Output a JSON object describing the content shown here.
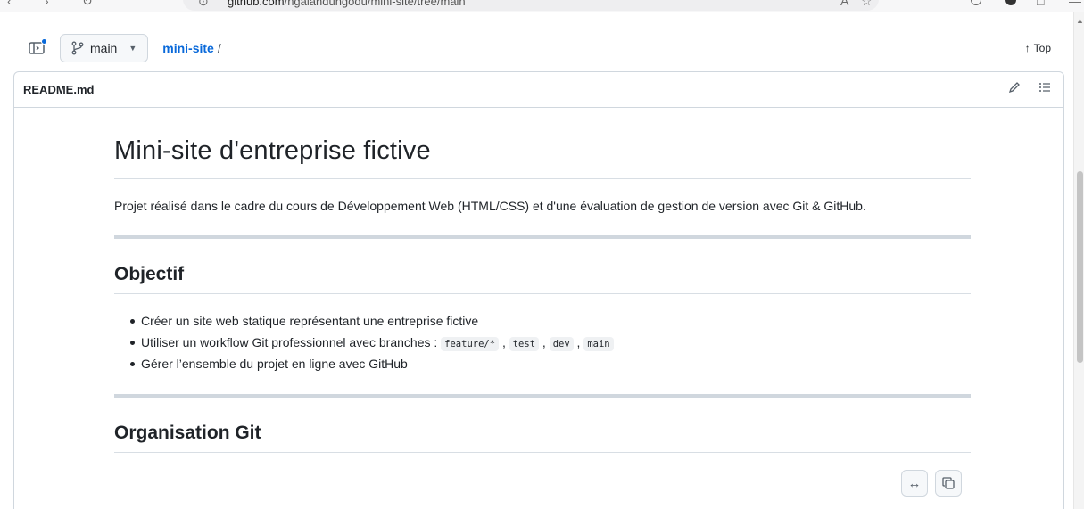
{
  "browser": {
    "url_host": "github.com",
    "url_path": "/ngalandungodu/mini-site/tree/main"
  },
  "repo_header": {
    "branch": "main",
    "repo_name": "mini-site",
    "path_separator": "/",
    "top_link": "Top"
  },
  "readme": {
    "filename": "README.md",
    "title": "Mini-site d'entreprise fictive",
    "intro": "Projet réalisé dans le cadre du cours de Développement Web (HTML/CSS) et d'une évaluation de gestion de version avec Git & GitHub.",
    "section1_heading": "Objectif",
    "bullets": {
      "b1": "Créer un site web statique représentant une entreprise fictive",
      "b2_prefix": "Utiliser un workflow Git professionnel avec branches : ",
      "b2_codes": [
        "feature/*",
        "test",
        "dev",
        "main"
      ],
      "b3": "Gérer l’ensemble du projet en ligne avec GitHub"
    },
    "section2_heading": "Organisation Git"
  },
  "icons": {
    "sidepanel": "sidepanel-toggle-icon",
    "branch": "git-branch-icon",
    "edit": "pencil-icon",
    "outline": "list-unordered-icon",
    "wrap": "left-right-arrow-icon",
    "copy": "copy-icon"
  },
  "colors": {
    "link": "#0969da",
    "text": "#1f2328",
    "border": "#d0d7de"
  }
}
